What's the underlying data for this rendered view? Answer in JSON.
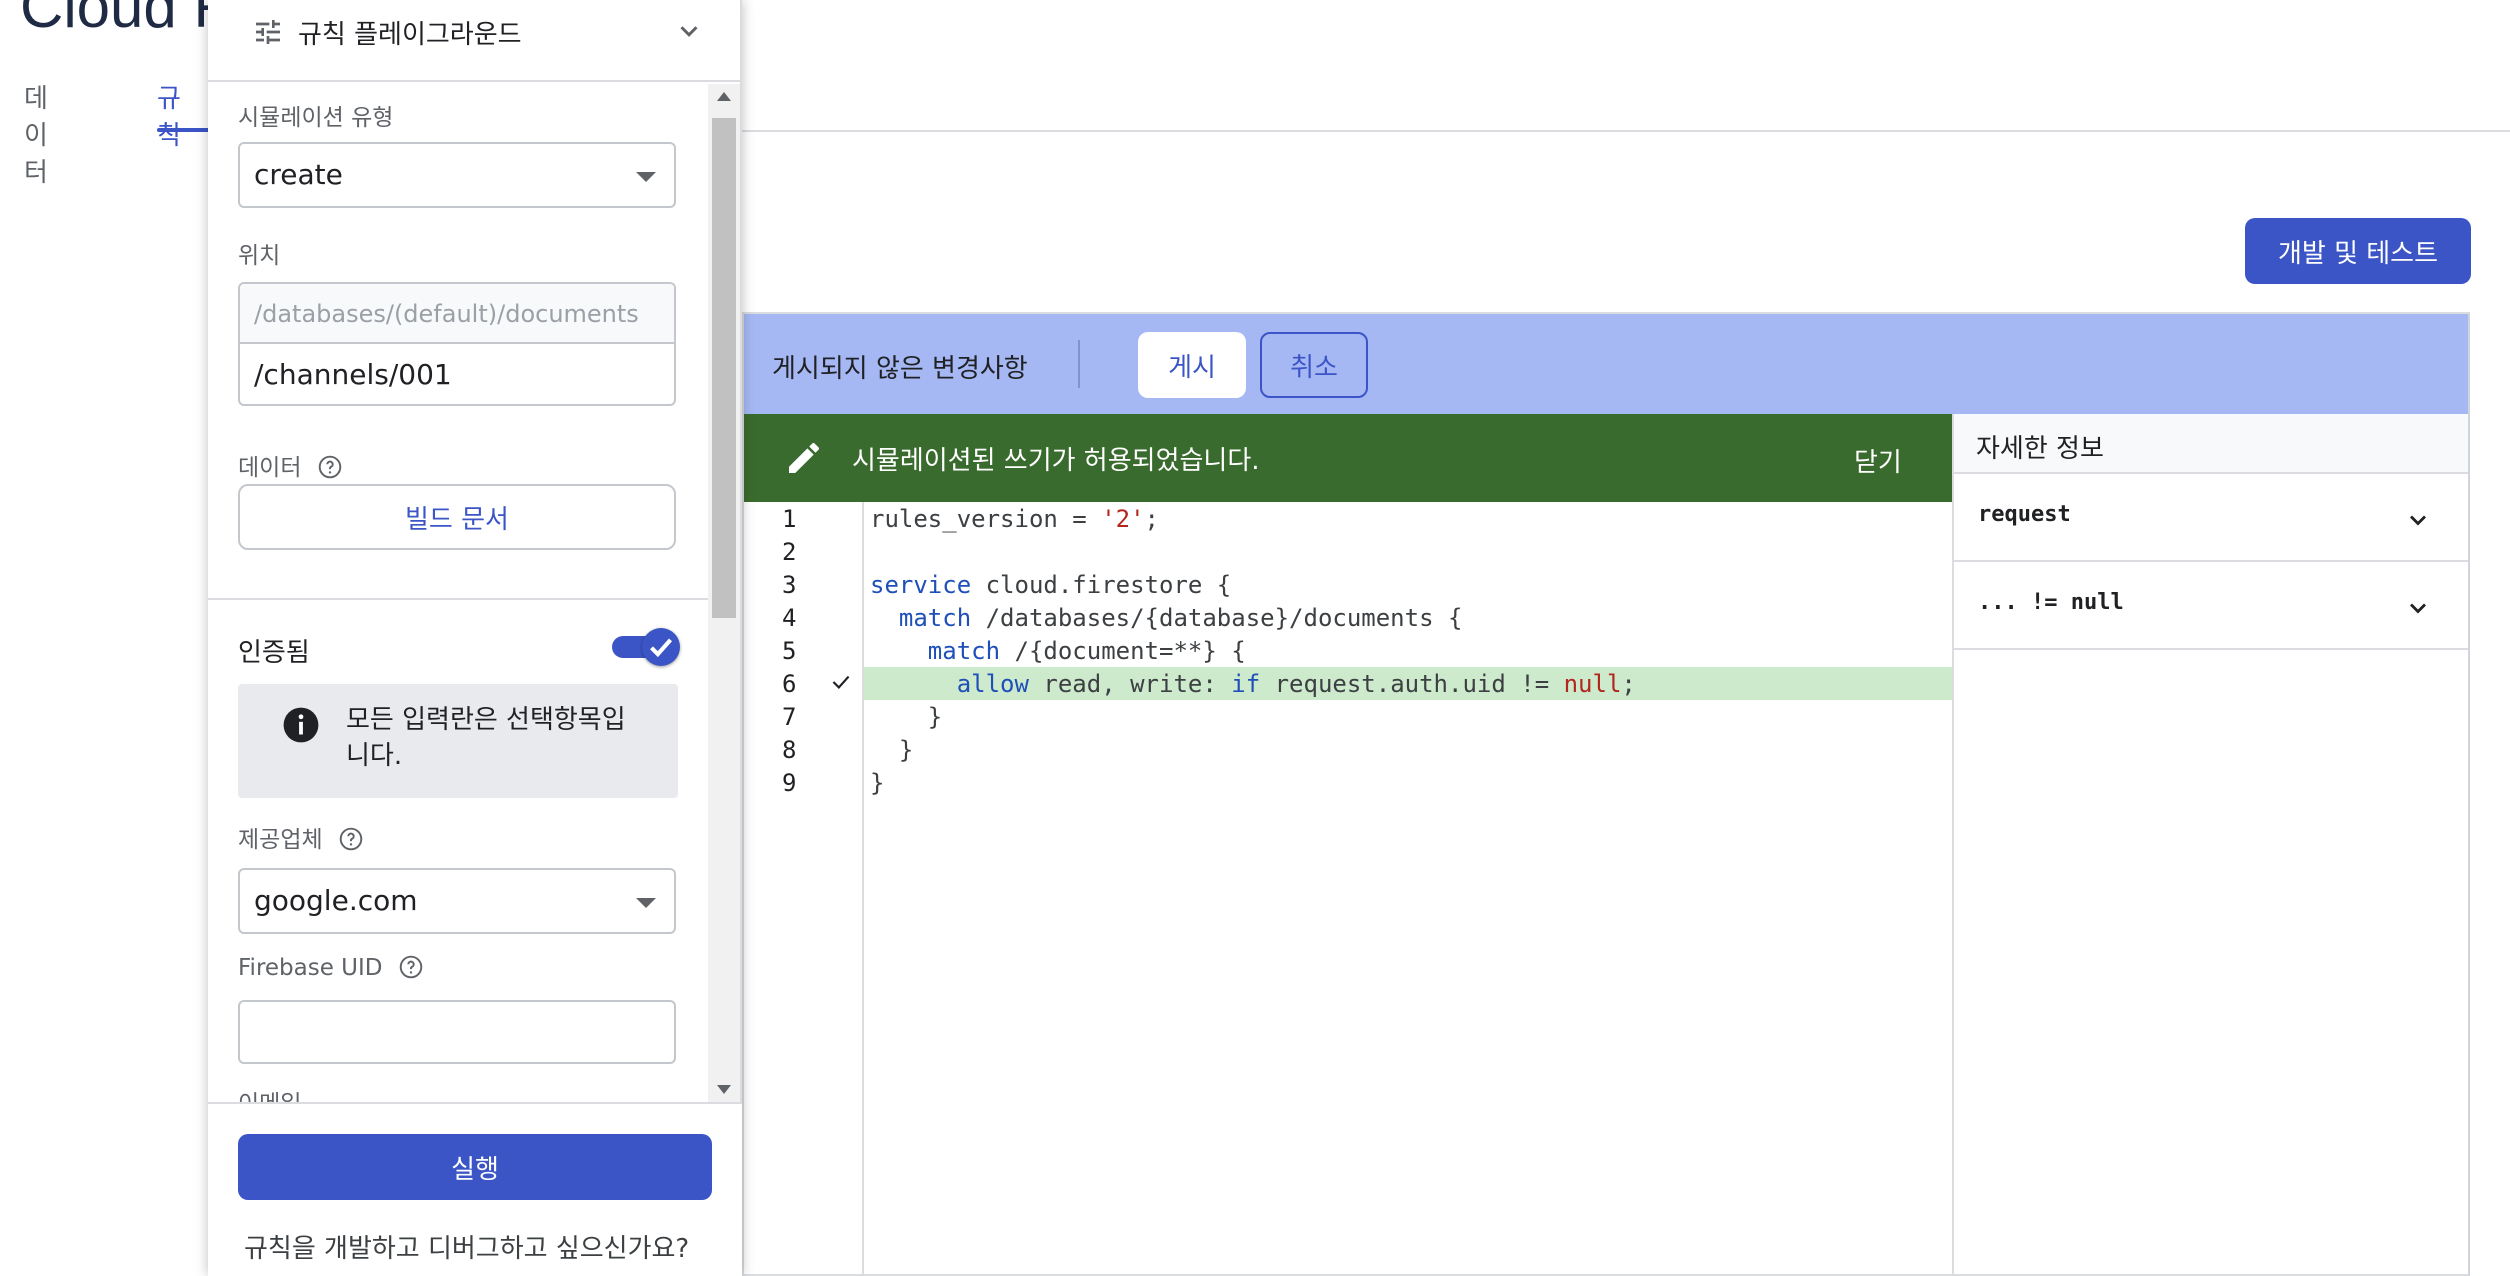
{
  "page": {
    "title": "Cloud F",
    "tabs": [
      {
        "label": "데이터"
      },
      {
        "label": "규칙"
      }
    ],
    "dev_test_button": "개발 및 테스트"
  },
  "banner": {
    "text": "게시되지 않은 변경사항",
    "publish": "게시",
    "cancel": "취소"
  },
  "success": {
    "text": "시뮬레이션된 쓰기가 허용되었습니다.",
    "close": "닫기"
  },
  "code": {
    "lines": [
      {
        "n": "1",
        "text": "rules_version = '2';"
      },
      {
        "n": "2",
        "text": ""
      },
      {
        "n": "3",
        "text": "service cloud.firestore {"
      },
      {
        "n": "4",
        "text": "  match /databases/{database}/documents {"
      },
      {
        "n": "5",
        "text": "    match /{document=**} {"
      },
      {
        "n": "6",
        "text": "      allow read, write: if request.auth.uid != null;"
      },
      {
        "n": "7",
        "text": "    }"
      },
      {
        "n": "8",
        "text": "  }"
      },
      {
        "n": "9",
        "text": "}"
      }
    ],
    "highlighted_line": 6
  },
  "details": {
    "title": "자세한 정보",
    "rows": [
      {
        "label": "request"
      },
      {
        "label": "... != null"
      }
    ]
  },
  "playground": {
    "title": "규칙 플레이그라운드",
    "sim_type_label": "시뮬레이션 유형",
    "sim_type_value": "create",
    "location_label": "위치",
    "location_prefix": "/databases/(default)/documents",
    "location_value": "/channels/001",
    "data_label": "데이터",
    "build_doc": "빌드 문서",
    "auth_label": "인증됨",
    "auth_enabled": true,
    "info_text": "모든 입력란은 선택항목입니다.",
    "provider_label": "제공업체",
    "provider_value": "google.com",
    "uid_label": "Firebase UID",
    "uid_value": "",
    "email_label": "이메일",
    "run": "실행",
    "debug_prompt": "규칙을 개발하고 디버그하고 싶으신가요?"
  },
  "colors": {
    "accent": "#3b55c7",
    "banner": "#a6b8f4",
    "success": "#3a6b2e",
    "highlight": "#ceeacc"
  }
}
